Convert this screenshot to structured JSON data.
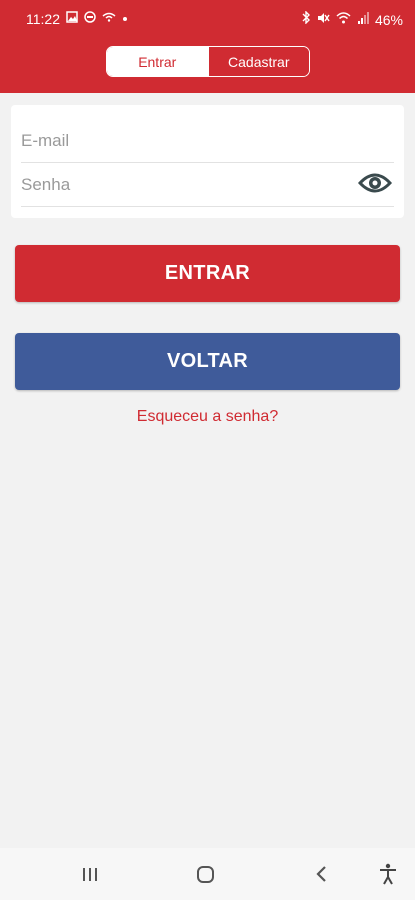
{
  "status_bar": {
    "time": "11:22",
    "battery": "46%",
    "icons_left": [
      "image-icon",
      "ring-icon",
      "wifi-ant-icon",
      "dot-icon"
    ],
    "icons_right": [
      "bluetooth-icon",
      "mute-icon",
      "wifi-icon",
      "signal-icon"
    ]
  },
  "tabs": {
    "login_label": "Entrar",
    "register_label": "Cadastrar",
    "selected": "Entrar"
  },
  "form": {
    "email_placeholder": "E-mail",
    "email_value": "",
    "password_placeholder": "Senha",
    "password_value": ""
  },
  "buttons": {
    "login_label": "ENTRAR",
    "back_label": "VOLTAR"
  },
  "forgot_password": "Esqueceu a senha?",
  "nav": [
    "recents-icon",
    "home-icon",
    "back-icon",
    "accessibility-icon"
  ],
  "colors": {
    "brand_red": "#d02b32",
    "brand_blue": "#3f5b9a",
    "background": "#f2f2f2"
  }
}
